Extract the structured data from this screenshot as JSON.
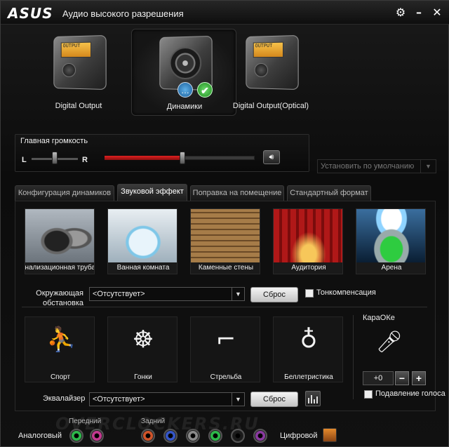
{
  "window": {
    "brand": "ASUS",
    "title": "Аудио высокого разрешения"
  },
  "devices": [
    {
      "label": "Digital Output",
      "screen": "OUTPUT",
      "selected": false
    },
    {
      "label": "Динамики",
      "selected": true
    },
    {
      "label": "Digital Output(Optical)",
      "screen": "OUTPUT",
      "selected": false
    }
  ],
  "volume": {
    "title": "Главная громкость",
    "left": "L",
    "right": "R",
    "level": 0.52,
    "balance": 0.5
  },
  "default_select": "Установить по умолчанию",
  "tabs": [
    {
      "label": "Конфигурация динамиков",
      "active": false
    },
    {
      "label": "Звуковой эффект",
      "active": true
    },
    {
      "label": "Поправка на помещение",
      "active": false
    },
    {
      "label": "Стандартный формат",
      "active": false
    }
  ],
  "environments": [
    {
      "label": "Канализационная труба"
    },
    {
      "label": "Ванная комната"
    },
    {
      "label": "Каменные стены"
    },
    {
      "label": "Аудитория"
    },
    {
      "label": "Арена"
    }
  ],
  "surround": {
    "label_line1": "Окружающая",
    "label_line2": "обстановка",
    "value": "<Отсутствует>",
    "reset": "Сброс",
    "tone_label": "Тонкомпенсация"
  },
  "modes": [
    {
      "label": "Спорт"
    },
    {
      "label": "Гонки"
    },
    {
      "label": "Стрельба"
    },
    {
      "label": "Беллетристика"
    }
  ],
  "karaoke": {
    "title": "КараОКе",
    "value": "+0",
    "minus": "−",
    "plus": "+",
    "voice_label": "Подавление голоса"
  },
  "equalizer": {
    "label": "Эквалайзер",
    "value": "<Отсутствует>",
    "reset": "Сброс"
  },
  "jacks": {
    "analog_label": "Аналоговый",
    "front_label": "Передний",
    "rear_label": "Задний",
    "digital_label": "Цифровой",
    "watermark": "OVERCLOCKERS.RU"
  },
  "colors": {
    "accent_red": "#d01818",
    "jack_green": "#2db84a",
    "jack_pink": "#c2388f",
    "jack_orange": "#d0542a",
    "jack_blue": "#3556c8",
    "jack_gray": "#8a8a8a",
    "jack_black": "#1a1a1a",
    "jack_purple": "#8a3aa0"
  }
}
